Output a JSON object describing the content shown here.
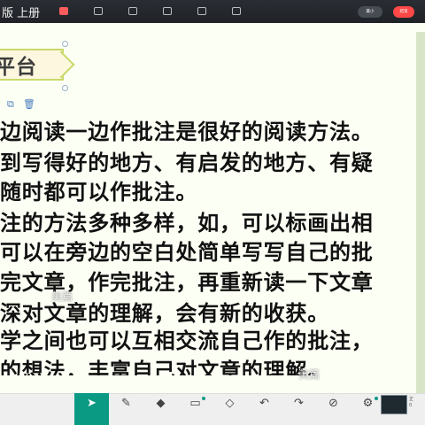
{
  "toolbar": {
    "book_title": "版 上册",
    "tools": [
      {
        "label": "",
        "icon": "slide-show-icon"
      },
      {
        "label": "",
        "icon": "record-icon"
      },
      {
        "label": "",
        "icon": "ppt-icon"
      },
      {
        "label": "",
        "icon": "apps-icon"
      },
      {
        "label": "",
        "icon": "screen-share-icon"
      },
      {
        "label": "",
        "icon": "more-icon"
      }
    ],
    "min_label": "最小",
    "close_label": "结束"
  },
  "slide": {
    "section_title": "平台",
    "lines": [
      "边阅读一边作批注是很好的阅读方法。",
      "到写得好的地方、有启发的地方、有疑",
      "随时都可以作批注。",
      "注的方法多种多样，如，可以标画出相",
      "可以在旁边的空白处简单写写自己的批",
      "完文章，作完批注，再重新读一下文章",
      "深对文章的理解，会有新的收获。",
      "学之间也可以互相交流自己作的批注，",
      "的想法，丰富自己对文章的理解。"
    ],
    "watermark": "美篇",
    "watermark_2": "美篇"
  },
  "bottom_toolbar": {
    "tools": [
      {
        "label": "",
        "icon": "select-arrow-icon",
        "active": true
      },
      {
        "label": "",
        "icon": "pen-icon"
      },
      {
        "label": "",
        "icon": "eraser-icon"
      },
      {
        "label": "",
        "icon": "text-icon"
      },
      {
        "label": "",
        "icon": "shapes-icon"
      },
      {
        "label": "",
        "icon": "undo-icon"
      },
      {
        "label": "",
        "icon": "redo-icon"
      },
      {
        "label": "",
        "icon": "clear-icon"
      },
      {
        "label": "",
        "icon": "tools-icon"
      }
    ]
  }
}
